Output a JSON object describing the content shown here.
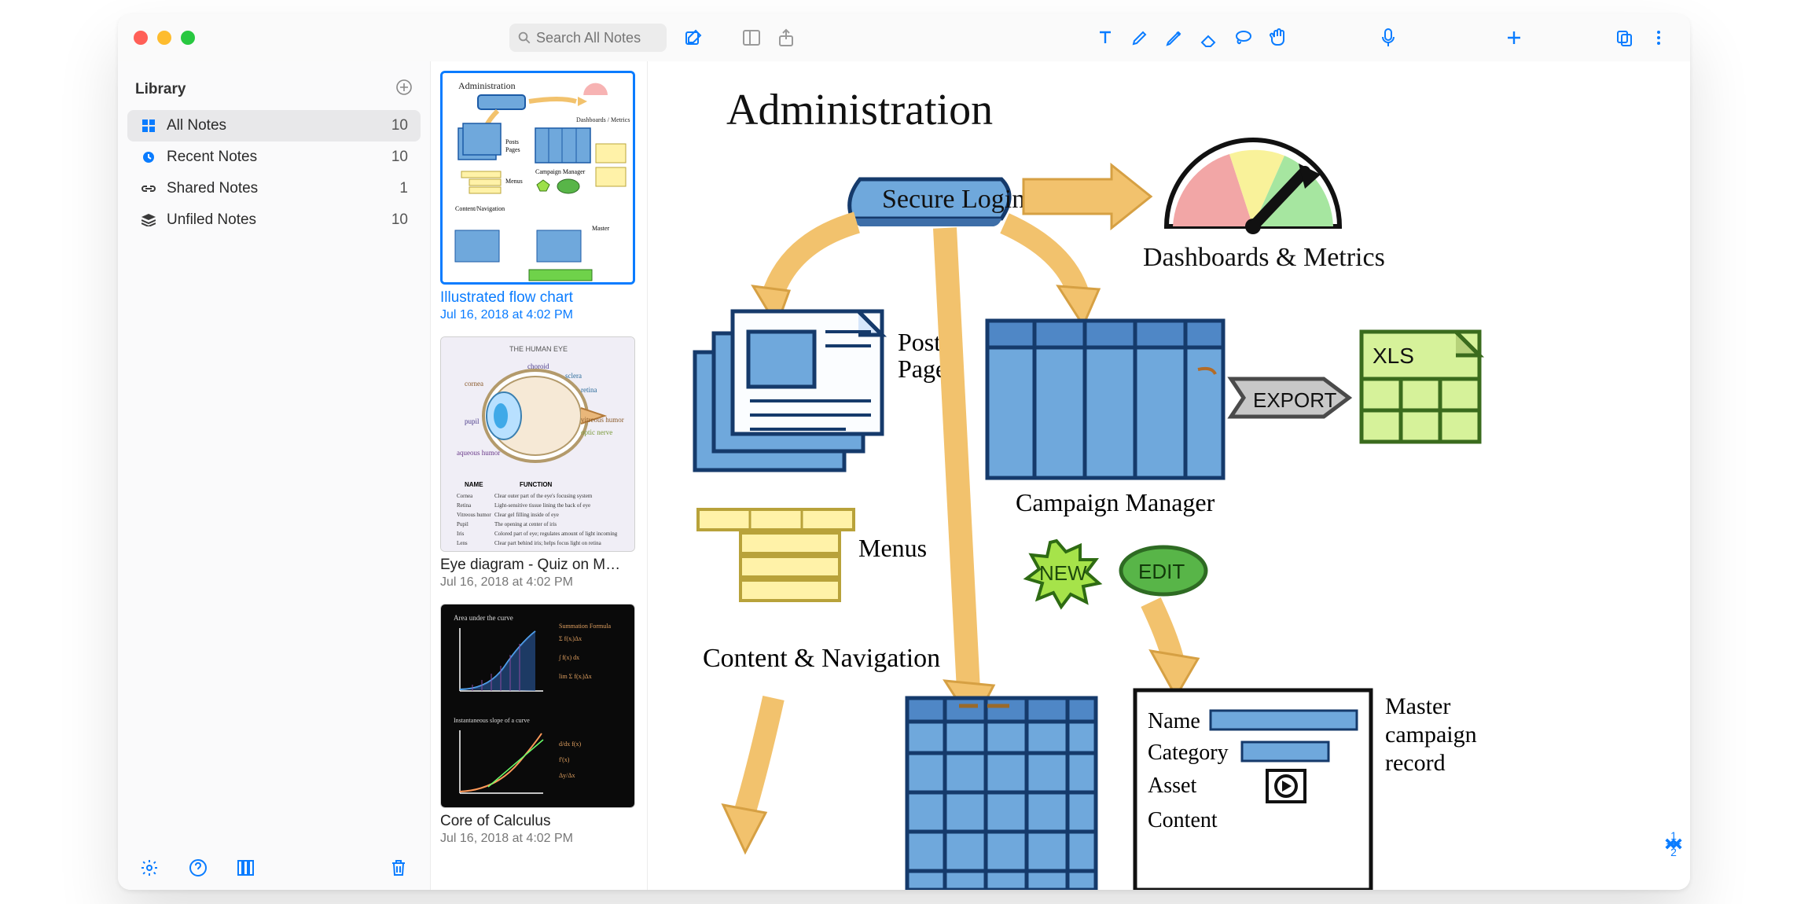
{
  "search": {
    "placeholder": "Search All Notes"
  },
  "sidebar": {
    "title": "Library",
    "items": [
      {
        "label": "All Notes",
        "count": "10",
        "icon": "grid"
      },
      {
        "label": "Recent Notes",
        "count": "10",
        "icon": "clock"
      },
      {
        "label": "Shared Notes",
        "count": "1",
        "icon": "link"
      },
      {
        "label": "Unfiled Notes",
        "count": "10",
        "icon": "stack"
      }
    ]
  },
  "notes": [
    {
      "title": "Illustrated flow chart",
      "date": "Jul 16, 2018 at 4:02 PM",
      "selected": true
    },
    {
      "title": "Eye diagram - Quiz on M…",
      "date": "Jul 16, 2018 at 4:02 PM",
      "selected": false
    },
    {
      "title": "Core of Calculus",
      "date": "Jul 16, 2018 at 4:02 PM",
      "selected": false
    }
  ],
  "pager": {
    "current": "1",
    "total": "2"
  },
  "drawing": {
    "title": "Administration",
    "secureLogin": "Secure Login",
    "dashboards": "Dashboards & Metrics",
    "postsPages1": "Posts",
    "postsPages2": "Pages",
    "export": "EXPORT",
    "xls": "XLS",
    "campaign": "Campaign Manager",
    "menus": "Menus",
    "newBtn": "NEW",
    "editBtn": "EDIT",
    "contentNav": "Content & Navigation",
    "master1": "Master",
    "master2": "campaign",
    "master3": "record",
    "formName": "Name",
    "formCategory": "Category",
    "formAsset": "Asset",
    "formContent": "Content"
  },
  "thumbs": {
    "eye": {
      "header": "THE HUMAN EYE",
      "choroid": "choroid",
      "sclera": "sclera",
      "retina": "retina",
      "vitreous": "vitreous humor",
      "optic": "optic nerve",
      "cornea": "cornea",
      "pupil": "pupil",
      "aqueous": "aqueous humor",
      "nameCol": "NAME",
      "funcCol": "FUNCTION"
    },
    "calc": {
      "area": "Area under the curve"
    }
  }
}
